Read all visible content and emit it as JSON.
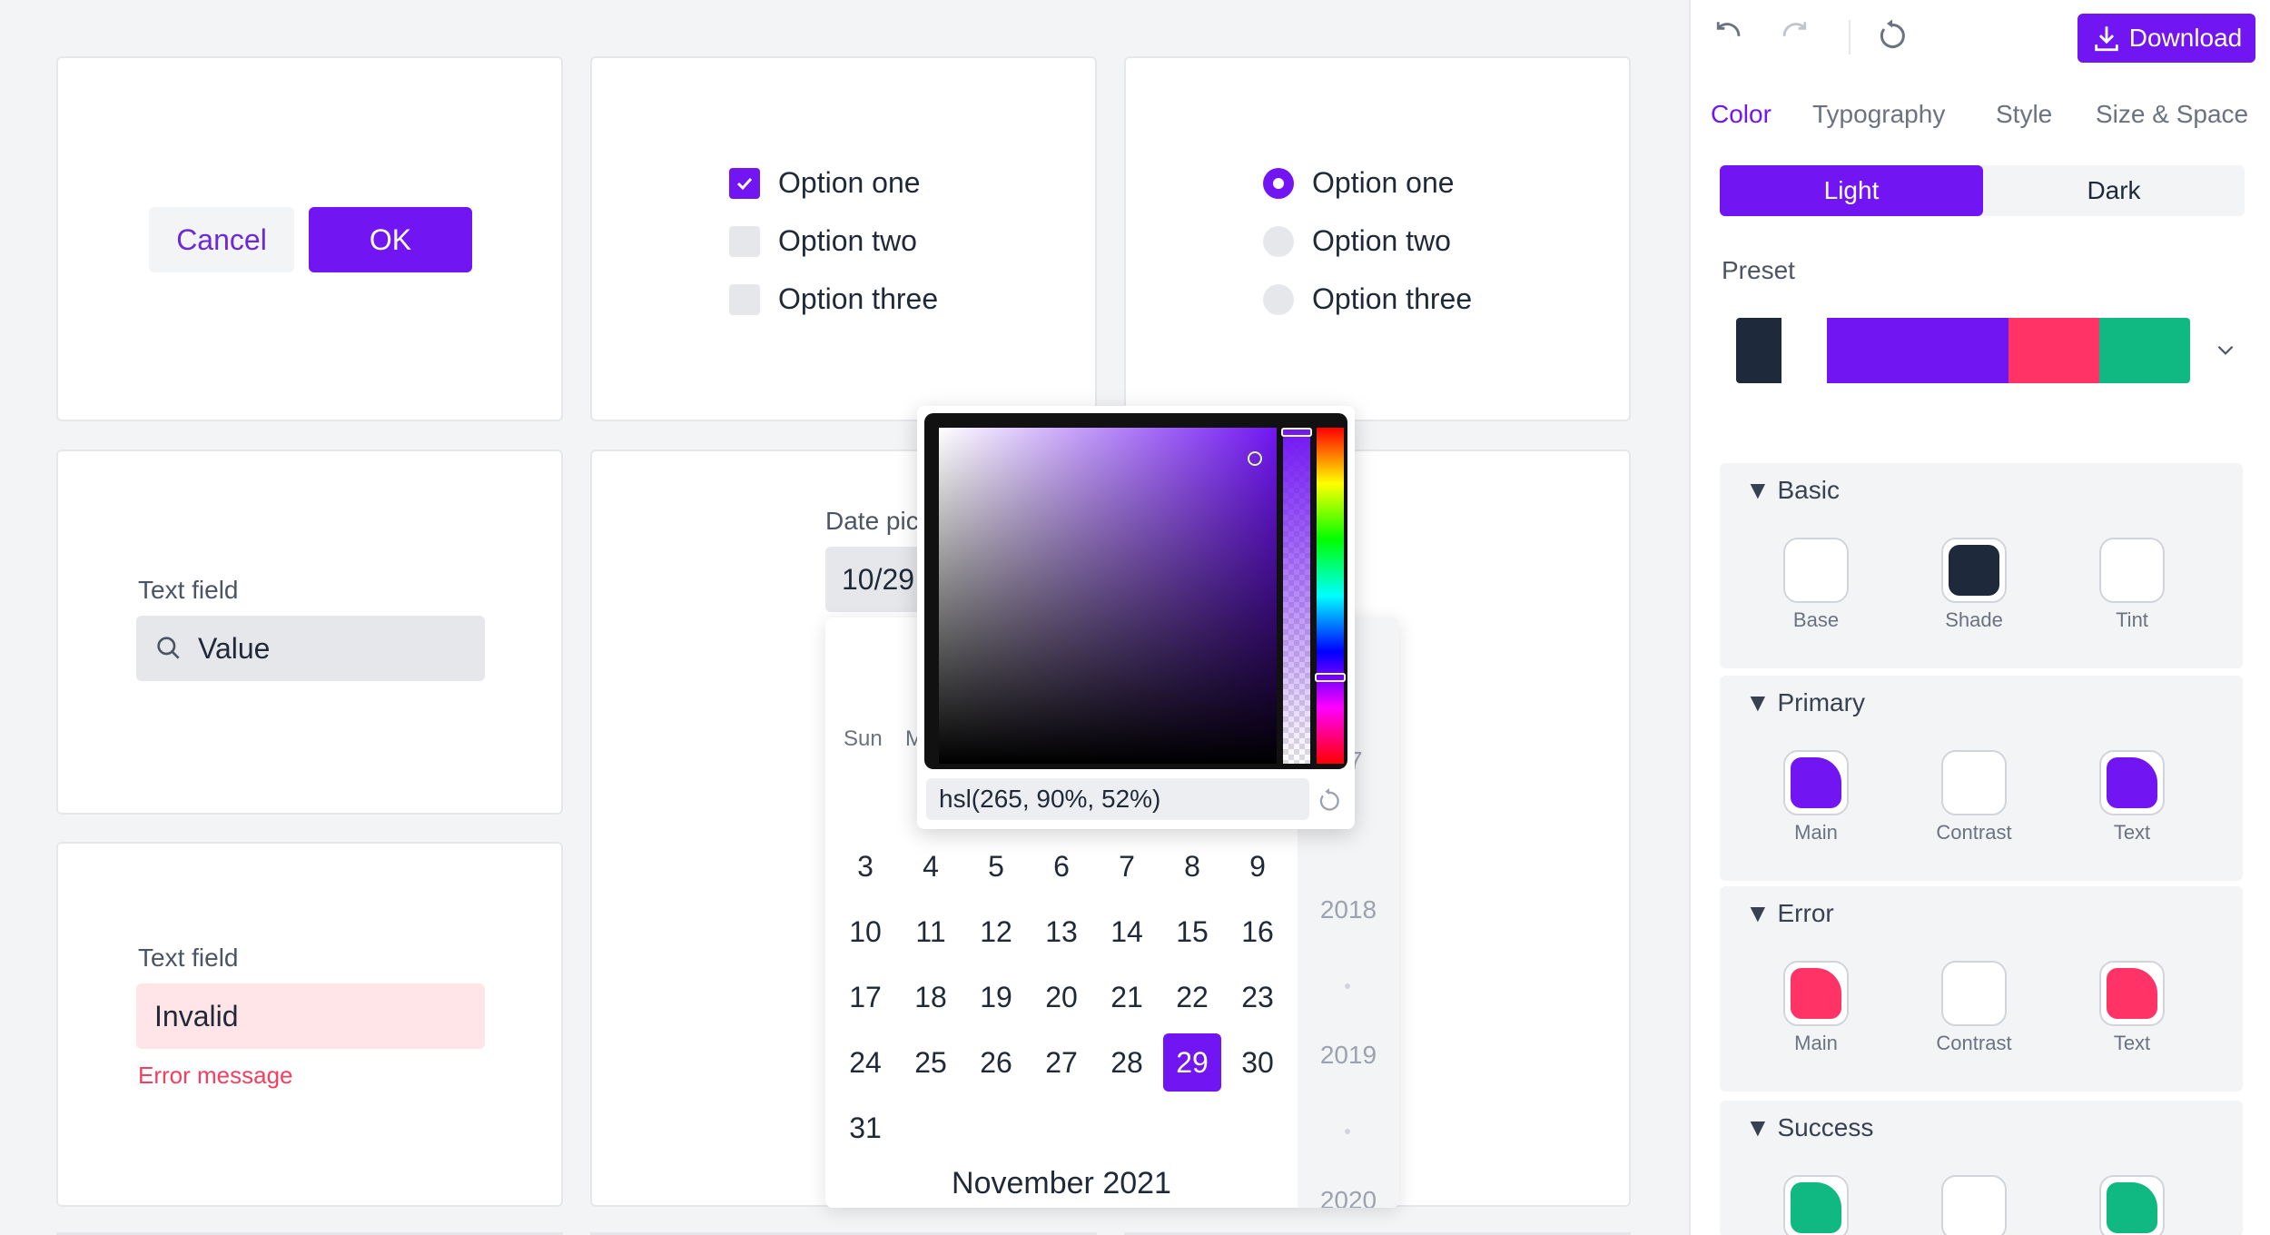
{
  "buttons": {
    "cancel": "Cancel",
    "ok": "OK"
  },
  "checkbox_group": {
    "options": [
      "Option one",
      "Option two",
      "Option three"
    ],
    "checked": "Option one"
  },
  "radio_group": {
    "options": [
      "Option one",
      "Option two",
      "Option three"
    ],
    "selected": "Option one"
  },
  "text_field_1": {
    "label": "Text field",
    "value": "Value",
    "icon": "search-icon"
  },
  "text_field_2": {
    "label": "Text field",
    "value": "Invalid",
    "error": "Error message"
  },
  "date_picker": {
    "label": "Date pic",
    "value": "10/29",
    "weekday_visible": [
      "Sun",
      "M"
    ],
    "days": [
      "3",
      "4",
      "5",
      "6",
      "7",
      "8",
      "9",
      "10",
      "11",
      "12",
      "13",
      "14",
      "15",
      "16",
      "17",
      "18",
      "19",
      "20",
      "21",
      "22",
      "23",
      "24",
      "25",
      "26",
      "27",
      "28",
      "29",
      "30",
      "31"
    ],
    "selected_day": "29",
    "month": "November 2021",
    "years": [
      "17",
      "2018",
      "2019",
      "2020"
    ]
  },
  "color_picker": {
    "value": "hsl(265, 90%, 52%)",
    "reset_icon": "reset-icon"
  },
  "panel": {
    "toolbar": {
      "undo_icon": "undo-icon",
      "redo_icon": "redo-icon",
      "reset_icon": "reset-icon",
      "download": "Download"
    },
    "tabs": [
      "Color",
      "Typography",
      "Style",
      "Size & Space"
    ],
    "active_tab": "Color",
    "mode": {
      "light": "Light",
      "dark": "Dark",
      "active": "Light"
    },
    "preset_label": "Preset",
    "preset_colors": [
      "#1e293b",
      "#ffffff",
      "#7116f3",
      "#ff3366",
      "#10b981"
    ],
    "sections": [
      {
        "title": "Basic",
        "swatches": [
          {
            "label": "Base",
            "color": "#ffffff"
          },
          {
            "label": "Shade",
            "color": "#1e293b"
          },
          {
            "label": "Tint",
            "color": "#ffffff"
          }
        ]
      },
      {
        "title": "Primary",
        "swatches": [
          {
            "label": "Main",
            "color": "#7116f3"
          },
          {
            "label": "Contrast",
            "color": "#ffffff"
          },
          {
            "label": "Text",
            "color": "#7116f3"
          }
        ]
      },
      {
        "title": "Error",
        "swatches": [
          {
            "label": "Main",
            "color": "#ff3366"
          },
          {
            "label": "Contrast",
            "color": "#ffffff"
          },
          {
            "label": "Text",
            "color": "#ff3366"
          }
        ]
      },
      {
        "title": "Success",
        "swatches": [
          {
            "label": "",
            "color": "#10b981"
          },
          {
            "label": "",
            "color": "#ffffff"
          },
          {
            "label": "",
            "color": "#10b981"
          }
        ]
      }
    ]
  },
  "colors": {
    "accent": "#7116f3",
    "error": "#ff3366",
    "success": "#10b981"
  }
}
